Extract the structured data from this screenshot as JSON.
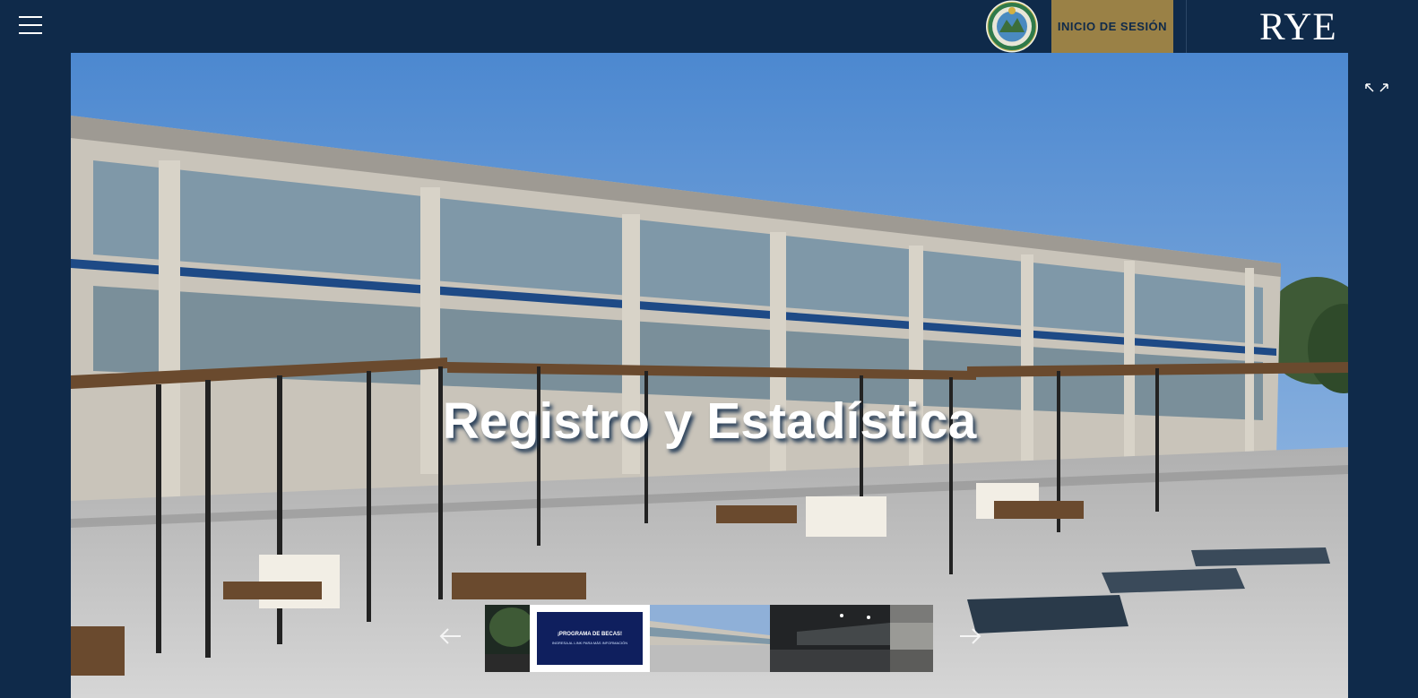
{
  "header": {
    "menu_icon": "hamburger-icon",
    "seal_icon": "university-seal-icon",
    "login_label": "INICIO DE SESIÓN",
    "logo_text": "RYE",
    "bg_color": "#0f2a4a",
    "accent_color": "#9a8146"
  },
  "hero": {
    "title": "Registro y Estadística",
    "expand_icon": "expand-icon",
    "prev_icon": "arrow-left-icon",
    "next_icon": "arrow-right-icon"
  },
  "carousel": {
    "promo_title": "¡PROGRAMA DE BECAS!",
    "promo_sub": "INGRESA AL LINK PARA MÁS INFORMACIÓN"
  }
}
